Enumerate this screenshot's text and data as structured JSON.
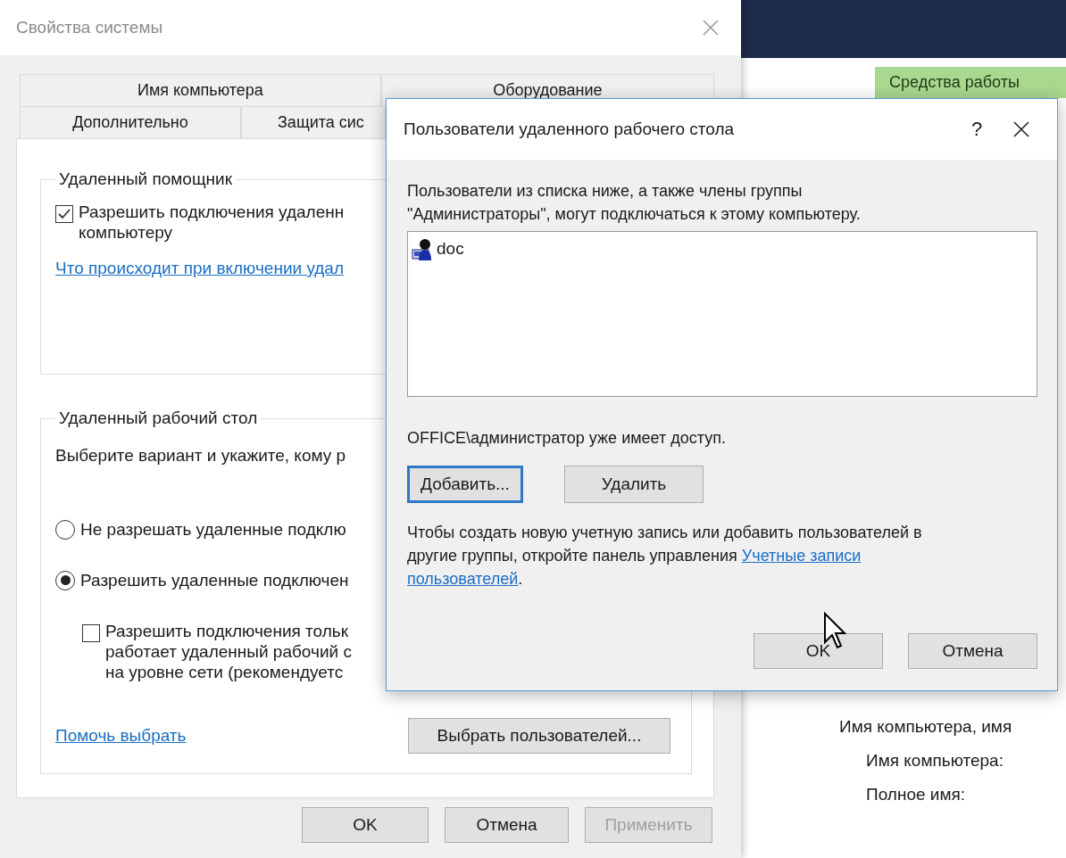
{
  "system_properties": {
    "title": "Свойства системы",
    "tab_rows": [
      [
        {
          "label": "Имя компьютера",
          "selected": false
        },
        {
          "label": "Оборудование",
          "selected": false
        }
      ],
      [
        {
          "label": "Дополнительно",
          "selected": false
        },
        {
          "label": "Защита сис",
          "selected": false
        }
      ]
    ],
    "remote_assistance": {
      "title": "Удаленный помощник",
      "checkbox": {
        "lines": [
          "Разрешить подключения удаленн",
          "компьютеру"
        ],
        "checked": true
      },
      "link": "Что происходит при включении удал"
    },
    "remote_desktop": {
      "title": "Удаленный рабочий стол",
      "hint": "Выберите вариант и укажите, кому р",
      "options": [
        {
          "label": "Не разрешать удаленные подклю",
          "selected": false
        },
        {
          "label": "Разрешить удаленные подключен",
          "selected": true
        }
      ],
      "nla_checkbox": {
        "lines": [
          "Разрешить подключения тольк",
          "работает удаленный рабочий с",
          "на уровне сети (рекомендуетс"
        ],
        "checked": false
      },
      "help_link": "Помочь выбрать",
      "select_users_button": "Выбрать пользователей..."
    },
    "buttons": [
      {
        "label": "OK",
        "disabled": false
      },
      {
        "label": "Отмена",
        "disabled": false
      },
      {
        "label": "Применить",
        "disabled": true
      }
    ]
  },
  "dialog": {
    "title": "Пользователи удаленного рабочего стола",
    "help": "?",
    "description_lines": [
      "Пользователи из списка ниже, а также члены группы",
      "\"Администраторы\", могут подключаться к этому компьютеру."
    ],
    "users": [
      {
        "name": "doc"
      }
    ],
    "access_note": "OFFICE\\администратор уже имеет доступ.",
    "buttons": [
      {
        "label": "Добавить...",
        "focused": true
      },
      {
        "label": "Удалить",
        "focused": false
      }
    ],
    "instruction": {
      "text_lines": [
        "Чтобы создать новую учетную запись или добавить пользователей в",
        "другие группы, откройте панель управления"
      ],
      "link_lines": [
        "Учетные записи",
        "пользователей"
      ],
      "after": "."
    },
    "footer_buttons": [
      "OK",
      "Отмена"
    ]
  },
  "background_window": {
    "ribbon_tab": "Средства работы",
    "section_title": "Имя компьютера, имя",
    "fields": [
      "Имя компьютера:",
      "Полное имя:"
    ]
  }
}
